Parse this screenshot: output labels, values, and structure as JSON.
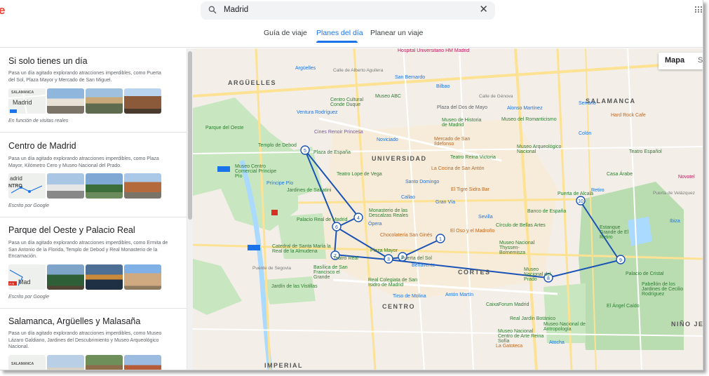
{
  "header": {
    "search_value": "Madrid",
    "tabs": [
      {
        "label": "Guía de viaje"
      },
      {
        "label": "Planes del día"
      },
      {
        "label": "Planear un viaje"
      }
    ]
  },
  "plans": [
    {
      "title": "Si solo tienes un día",
      "description": "Pasa un día agitado explorando atracciones imperdibles, como Puerta del Sol, Plaza Mayor y Mercado de San Miguel.",
      "source": "En función de visitas reales",
      "map_thumb_text": "Madrid",
      "map_thumb_sub": "SALAMANCA"
    },
    {
      "title": "Centro de Madrid",
      "description": "Pasa un día agitado explorando atracciones imperdibles, como Plaza Mayor, Kilómetro Cero y Museo Nacional del Prado.",
      "source": "Escrito por Google",
      "map_thumb_text": "adrid",
      "map_thumb_sub": "NTRO"
    },
    {
      "title": "Parque del Oeste y Palacio Real",
      "description": "Pasa un día agitado explorando atracciones imperdibles, como Ermita de San Antonio de la Florida, Templo de Debod y Real Monasterio de la Encarnación.",
      "source": "Escrito por Google",
      "map_thumb_text": "Mad",
      "map_thumb_sub": "A-5"
    },
    {
      "title": "Salamanca, Argüelles y Malasaña",
      "description": "Pasa un día agitado explorando atracciones imperdibles, como Museo Lázaro Galdiano, Jardines del Descubrimiento y Museo Arqueológico Nacional.",
      "source": "",
      "map_thumb_text": "",
      "map_thumb_sub": "SALAMANCA"
    }
  ],
  "map": {
    "map_type_label": "Mapa",
    "sat_label": "S",
    "districts": [
      "ARGÜELLES",
      "UNIVERSIDAD",
      "SALAMANCA",
      "CORTES",
      "CENTRO",
      "IMPERIAL",
      "NIÑO JE"
    ],
    "route_stops": [
      "1",
      "2",
      "3",
      "4",
      "5",
      "6",
      "7",
      "8",
      "9",
      "10"
    ],
    "labels": [
      "Hospital Universitario HM Madrid",
      "Argüelles",
      "Calle de Alberto Aguilera",
      "San Bernardo",
      "Bilbao",
      "Calle de Génova",
      "Hard Rock Cafe",
      "Serrano",
      "Colón",
      "Centro Cultural Conde Duque",
      "Museo ABC",
      "Plaza del Dos de Mayo",
      "Alonso Martínez",
      "Ventura Rodríguez",
      "Parque del Oeste",
      "Museo de Historia de Madrid",
      "Museo del Romanticismo",
      "Cines Renoir Princesa",
      "Noviciado",
      "Mercado de San Ildefonso",
      "Museo Arqueológico Nacional",
      "Templo de Debod",
      "Plaza de España",
      "Teatro Lope de Vega",
      "La Cocina de San Antón",
      "Teatro Español",
      "Museo Centro Comercial Príncipe Pío",
      "Santo Domingo",
      "Callao",
      "El Tigre Sidra Bar",
      "Gran Vía",
      "Príncipe Pío",
      "Jardines de Sabatini",
      "Banco de España",
      "Puerta de Alcalá",
      "Retiro",
      "Palacio Real de Madrid",
      "Monasterio de las Descalzas Reales",
      "Ópera",
      "Chocolatería San Ginés",
      "El Oso y el Madroño",
      "Círculo de Bellas Artes",
      "Estanque Grande de El Retiro",
      "Catedral de Santa María la Real de la Almudena",
      "Plaza Mayor",
      "Museo Nacional Thyssen-Bornemisza",
      "Puerta del Sol",
      "Teatro Real",
      "Basílica de San Francisco el Grande",
      "Puente de Segovia",
      "Museo Nacional del Prado",
      "Palacio de Cristal",
      "Jardín de las Vistillas",
      "Real Colegiata de San Isidro de Madrid",
      "Tirso de Molina",
      "Antón Martín",
      "CaixaForum Madrid",
      "Museo Nacional Centro de Arte Reina Sofía",
      "La Gatoteca",
      "Atocha",
      "Museo Nacional de Antropología",
      "Real Jardín Botánico",
      "El Ángel Caído",
      "Pabellón de los Jardines de Cecilio Rodríguez",
      "Ibiza",
      "Novotel",
      "Casa Árabe",
      "Puerta de Velázquez",
      "Teatro Reina Victoria",
      "Benavente",
      "Sevilla"
    ]
  }
}
